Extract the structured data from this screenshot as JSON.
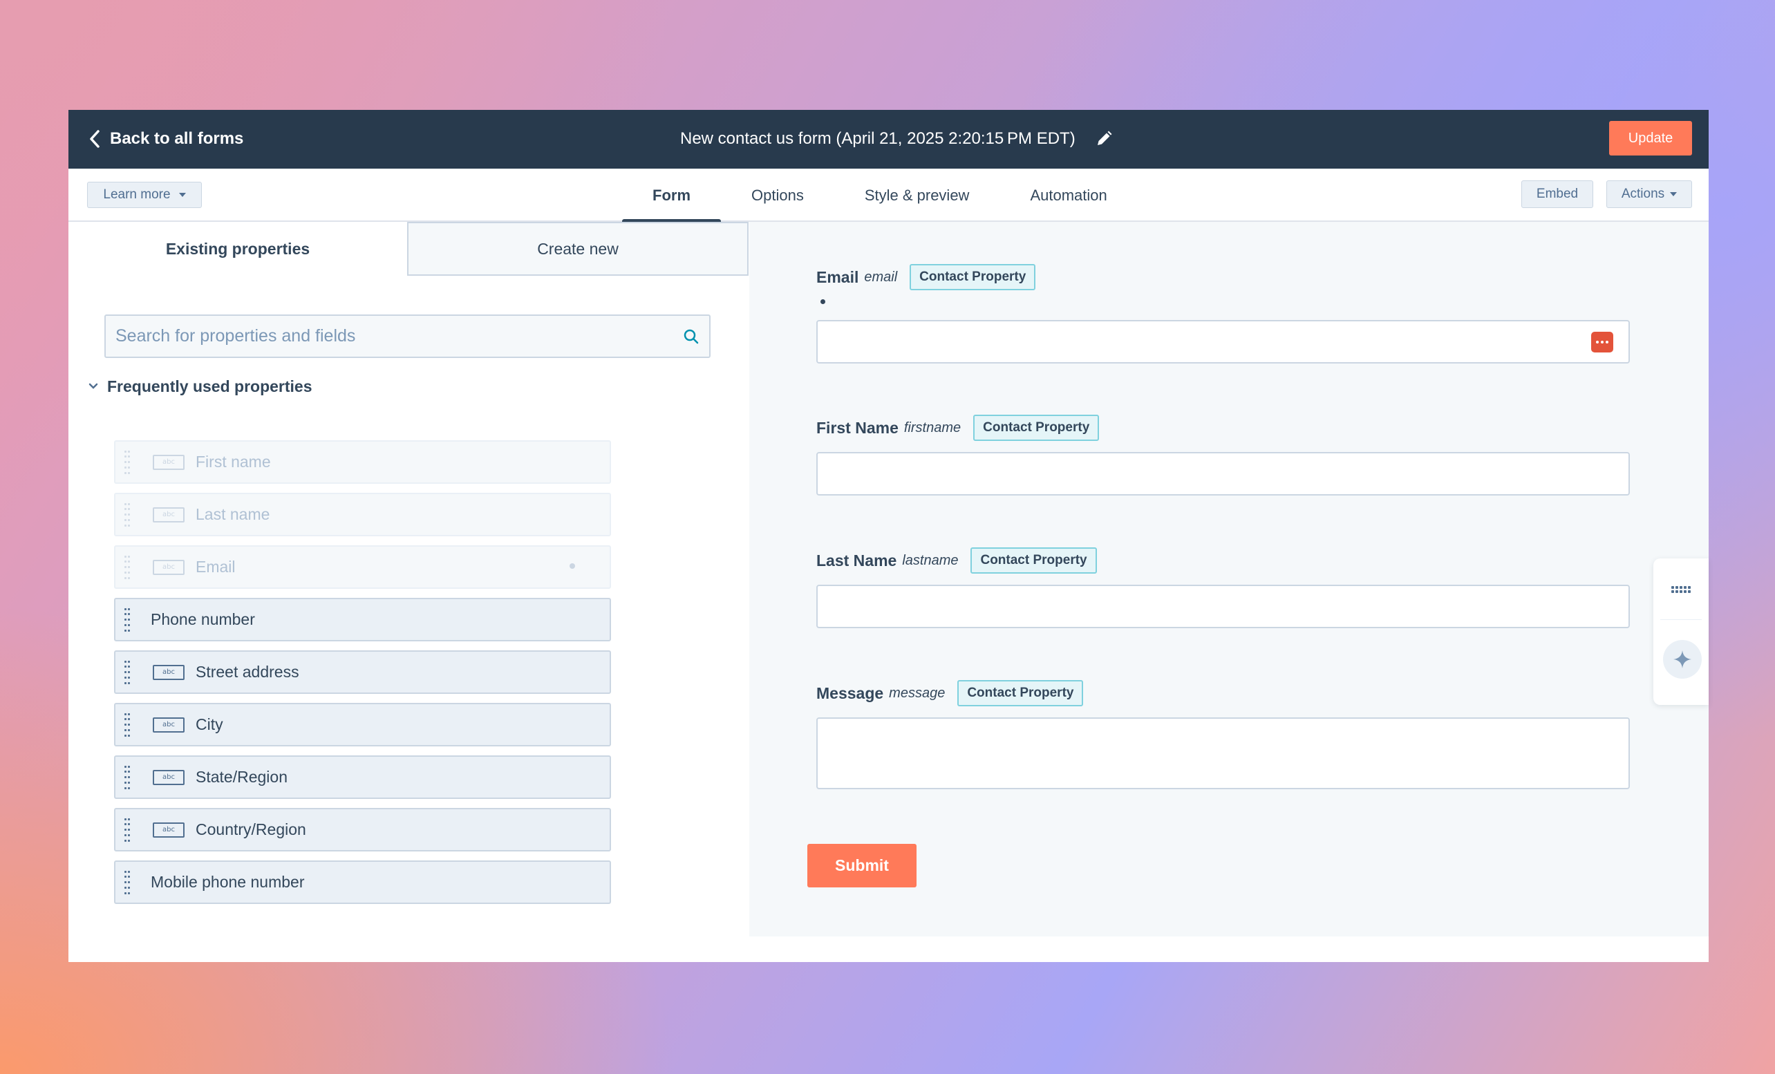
{
  "topbar": {
    "back_label": "Back to all forms",
    "form_title": "New contact us form (April 21, 2025 2:20:15 PM EDT)",
    "update_label": "Update"
  },
  "tabbar": {
    "learn_more": "Learn more",
    "tabs": [
      "Form",
      "Options",
      "Style & preview",
      "Automation"
    ],
    "active_tab": "Form",
    "embed_label": "Embed",
    "actions_label": "Actions"
  },
  "left_panel": {
    "tabs": {
      "existing": "Existing properties",
      "create": "Create new"
    },
    "search_placeholder": "Search for properties and fields",
    "section_title": "Frequently used properties",
    "properties": [
      {
        "label": "First name",
        "icon": "text-field-icon",
        "disabled": true
      },
      {
        "label": "Last name",
        "icon": "text-field-icon",
        "disabled": true
      },
      {
        "label": "Email",
        "icon": "text-field-icon",
        "disabled": true
      },
      {
        "label": "Phone number",
        "icon": "",
        "disabled": false
      },
      {
        "label": "Street address",
        "icon": "text-field-icon",
        "disabled": false
      },
      {
        "label": "City",
        "icon": "text-field-icon",
        "disabled": false
      },
      {
        "label": "State/Region",
        "icon": "text-field-icon",
        "disabled": false
      },
      {
        "label": "Country/Region",
        "icon": "text-field-icon",
        "disabled": false
      },
      {
        "label": "Mobile phone number",
        "icon": "",
        "disabled": false
      }
    ],
    "abc_text": "abc"
  },
  "form_preview": {
    "fields": [
      {
        "label": "Email",
        "internal": "email",
        "badge": "Contact Property",
        "required": true
      },
      {
        "label": "First Name",
        "internal": "firstname",
        "badge": "Contact Property"
      },
      {
        "label": "Last Name",
        "internal": "lastname",
        "badge": "Contact Property"
      },
      {
        "label": "Message",
        "internal": "message",
        "badge": "Contact Property"
      }
    ],
    "submit_label": "Submit"
  },
  "colors": {
    "topbar": "#283a4d",
    "accent_orange": "#ff7a59",
    "badge_border": "#7fd1de",
    "password_icon": "#e3533a"
  }
}
